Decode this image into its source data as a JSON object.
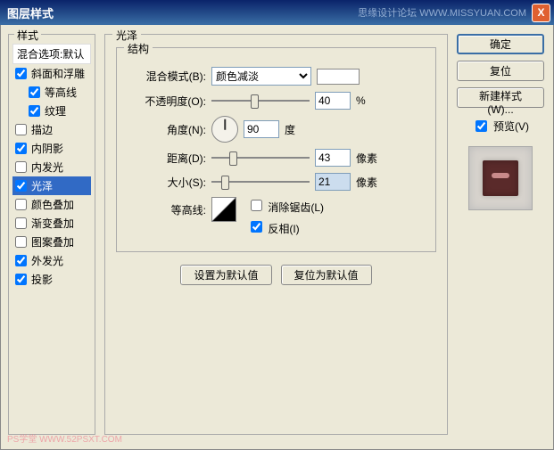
{
  "window": {
    "title": "图层样式",
    "watermark": "思缘设计论坛  WWW.MISSYUAN.COM",
    "close": "X"
  },
  "left": {
    "legend": "样式",
    "blendHeader": "混合选项:默认",
    "items": [
      {
        "label": "斜面和浮雕",
        "checked": true,
        "indent": false
      },
      {
        "label": "等高线",
        "checked": true,
        "indent": true
      },
      {
        "label": "纹理",
        "checked": true,
        "indent": true
      },
      {
        "label": "描边",
        "checked": false,
        "indent": false
      },
      {
        "label": "内阴影",
        "checked": true,
        "indent": false
      },
      {
        "label": "内发光",
        "checked": false,
        "indent": false
      },
      {
        "label": "光泽",
        "checked": true,
        "indent": false,
        "selected": true
      },
      {
        "label": "颜色叠加",
        "checked": false,
        "indent": false
      },
      {
        "label": "渐变叠加",
        "checked": false,
        "indent": false
      },
      {
        "label": "图案叠加",
        "checked": false,
        "indent": false
      },
      {
        "label": "外发光",
        "checked": true,
        "indent": false
      },
      {
        "label": "投影",
        "checked": true,
        "indent": false
      }
    ]
  },
  "main": {
    "legend": "光泽",
    "subLegend": "结构",
    "blendModeLabel": "混合模式(B):",
    "blendModeValue": "颜色减淡",
    "opacityLabel": "不透明度(O):",
    "opacityValue": "40",
    "opacityUnit": "%",
    "angleLabel": "角度(N):",
    "angleValue": "90",
    "angleUnit": "度",
    "distanceLabel": "距离(D):",
    "distanceValue": "43",
    "distanceUnit": "像素",
    "sizeLabel": "大小(S):",
    "sizeValue": "21",
    "sizeUnit": "像素",
    "contourLabel": "等高线:",
    "antialiasLabel": "消除锯齿(L)",
    "invertLabel": "反相(I)",
    "antialiasChecked": false,
    "invertChecked": true,
    "btnDefault": "设置为默认值",
    "btnReset": "复位为默认值"
  },
  "right": {
    "ok": "确定",
    "cancel": "复位",
    "newStyle": "新建样式(W)...",
    "previewLabel": "预览(V)",
    "previewChecked": true
  },
  "footer": {
    "wm": "PS学堂  WWW.52PSXT.COM"
  }
}
